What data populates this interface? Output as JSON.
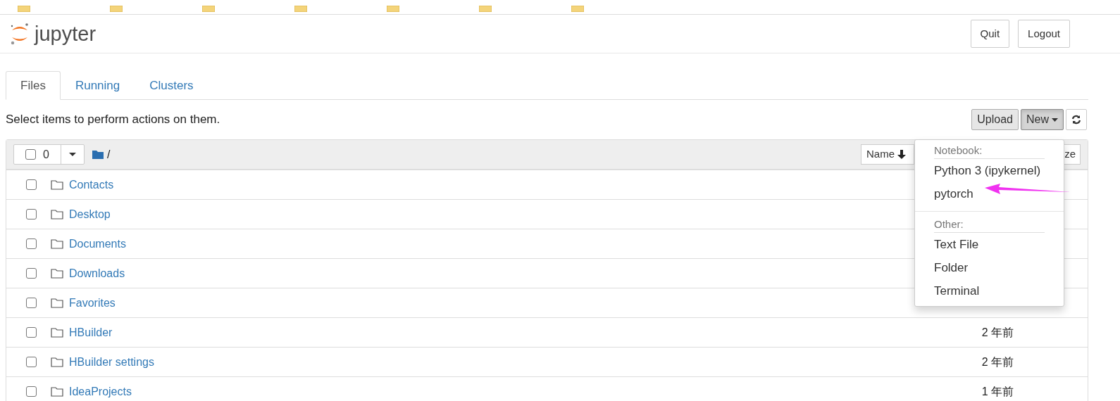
{
  "bookmarks_bar": {
    "folders": [
      {
        "kind": "folder"
      },
      {
        "kind": "folder"
      },
      {
        "kind": "folder"
      },
      {
        "kind": "folder"
      },
      {
        "kind": "folder"
      },
      {
        "kind": "folder"
      },
      {
        "kind": "folder"
      }
    ]
  },
  "header": {
    "logo": "jupyter",
    "buttons": [
      "Quit",
      "Logout"
    ]
  },
  "tabs": [
    {
      "label": "Files",
      "selected": true
    },
    {
      "label": "Running",
      "selected": false
    },
    {
      "label": "Clusters",
      "selected": false
    }
  ],
  "toolbar": {
    "hint": "Select items to perform actions on them.",
    "upload": "Upload",
    "new": "New",
    "new_open": true
  },
  "list_header": {
    "select_all_checked": false,
    "selected_count": "0",
    "path": "/",
    "sort_name": "Name",
    "size_column": "ze"
  },
  "rows": [
    {
      "name": "Contacts",
      "checked": false
    },
    {
      "name": "Desktop",
      "checked": false
    },
    {
      "name": "Documents",
      "checked": false
    },
    {
      "name": "Downloads",
      "checked": false
    },
    {
      "name": "Favorites",
      "checked": false
    },
    {
      "name": "HBuilder",
      "checked": false,
      "modified": "2 年前"
    },
    {
      "name": "HBuilder settings",
      "checked": false,
      "modified": "2 年前"
    },
    {
      "name": "IdeaProjects",
      "checked": false,
      "modified": "1 年前"
    }
  ],
  "new_menu": {
    "sections": [
      {
        "header": "Notebook:",
        "items": [
          "Python 3 (ipykernel)",
          "pytorch"
        ]
      },
      {
        "header": "Other:",
        "items": [
          "Text File",
          "Folder",
          "Terminal"
        ]
      }
    ]
  },
  "annotation": {
    "kind": "arrow"
  }
}
